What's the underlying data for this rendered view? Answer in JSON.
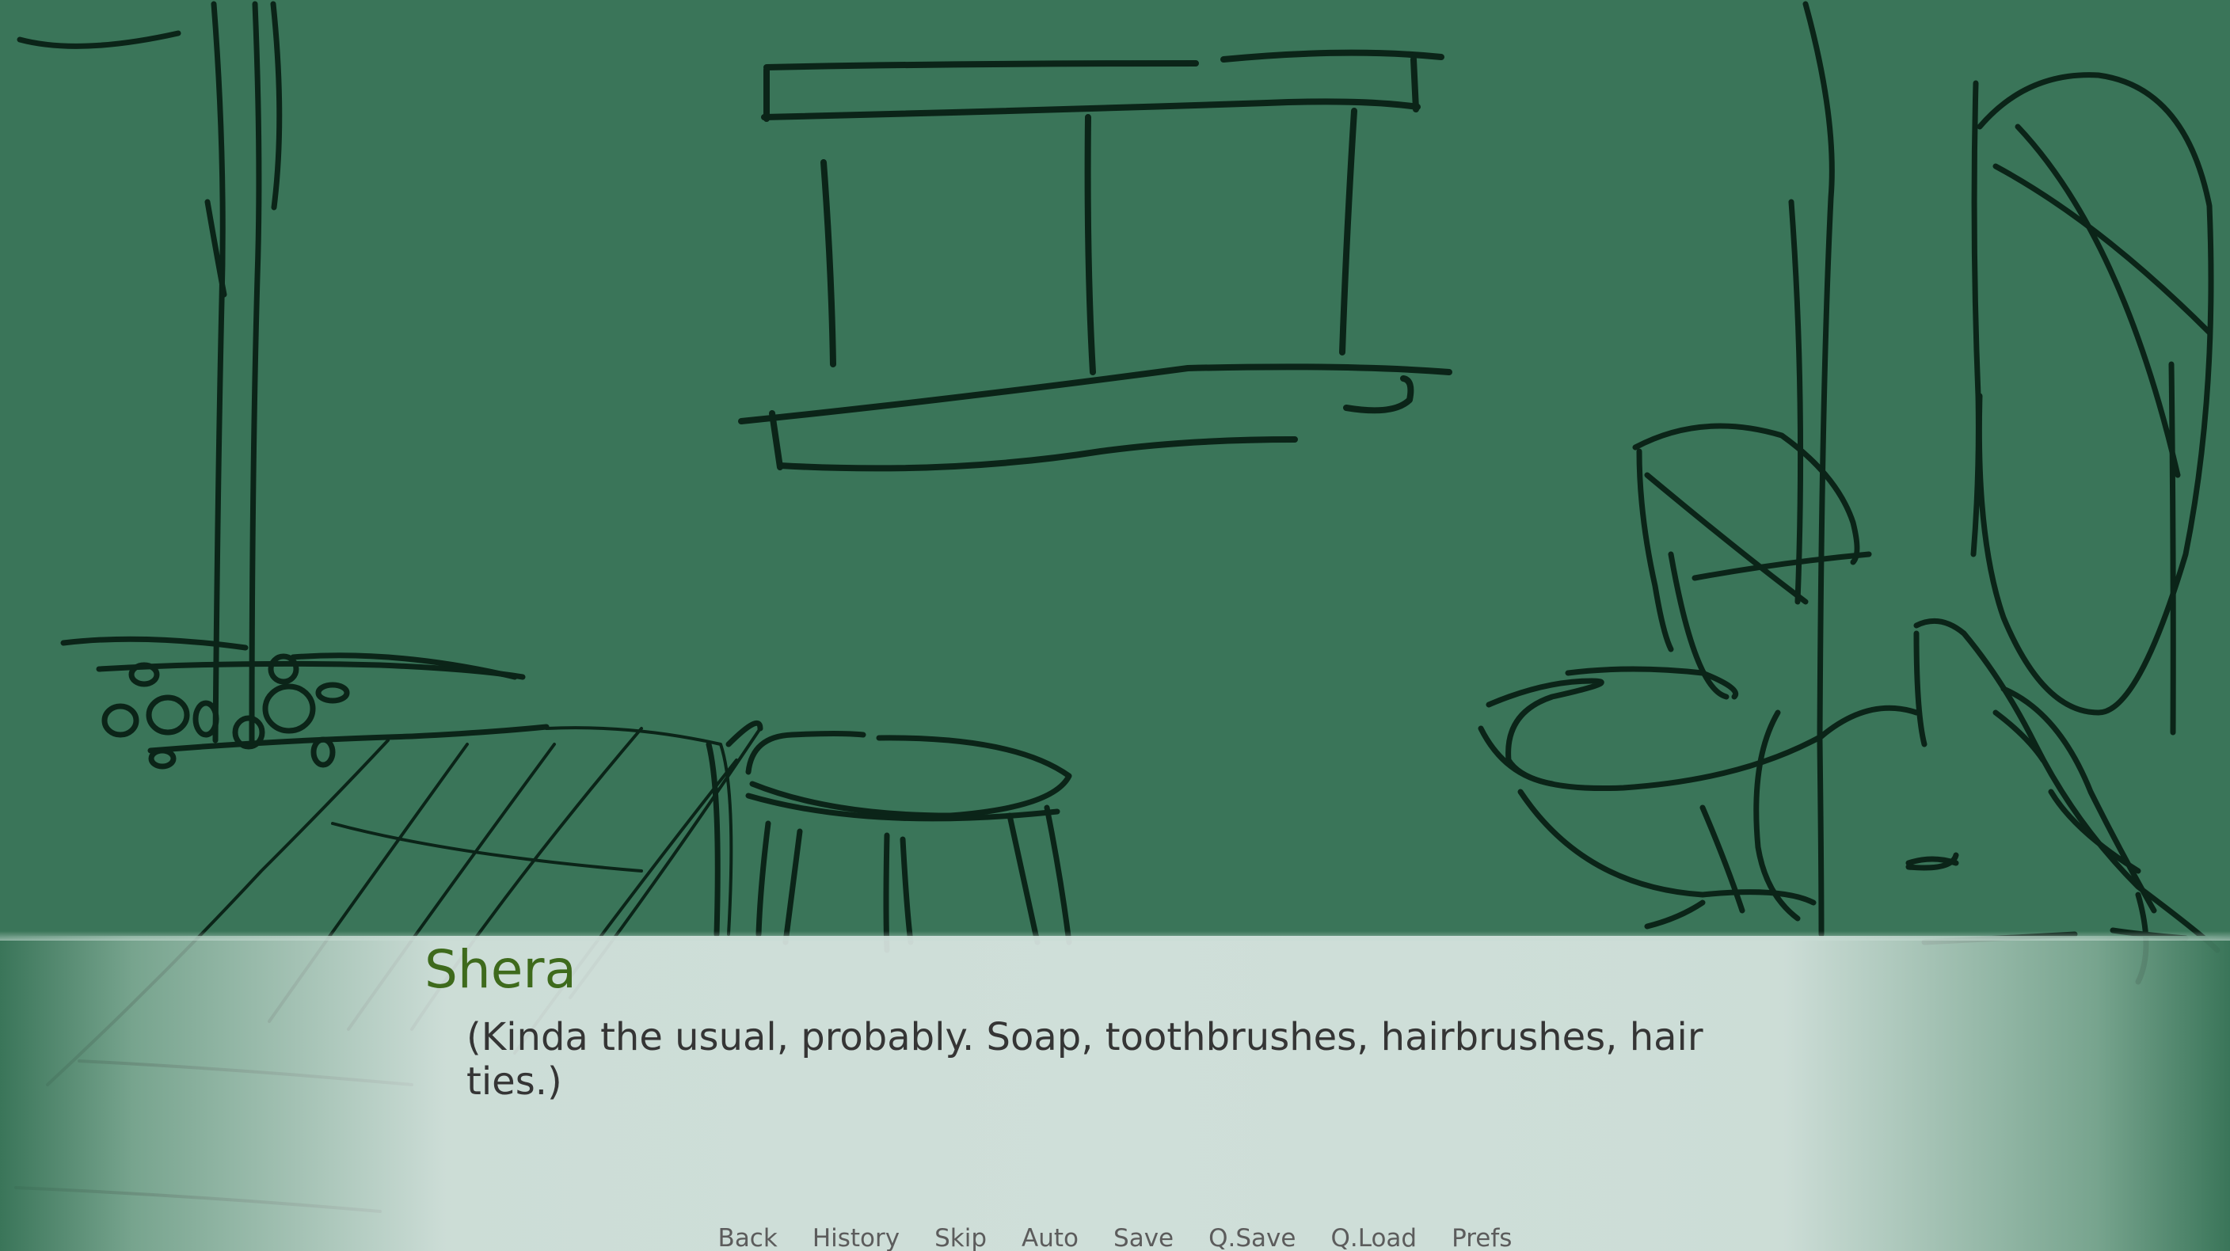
{
  "scene": {
    "background_color": "#3a7559",
    "line_color": "#0b2418"
  },
  "dialogue": {
    "speaker": "Shera",
    "speaker_color": "#3e6a1c",
    "text": "(Kinda the usual, probably. Soap, toothbrushes, hairbrushes, hair ties.)"
  },
  "quick_menu": {
    "back": "Back",
    "history": "History",
    "skip": "Skip",
    "auto": "Auto",
    "save": "Save",
    "qsave": "Q.Save",
    "qload": "Q.Load",
    "prefs": "Prefs"
  }
}
